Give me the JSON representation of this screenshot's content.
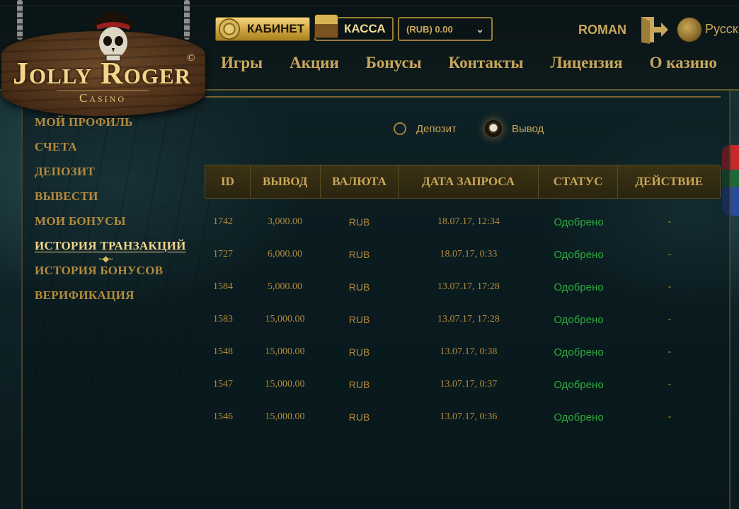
{
  "brand": {
    "title": "Jolly Roger",
    "subtitle": "Casino",
    "copyright": "©"
  },
  "header": {
    "cabinet_label": "КАБИНЕТ",
    "kassa_label": "КАССА",
    "balance": "(RUB) 0.00",
    "username": "ROMAN",
    "language": "Русск"
  },
  "nav": [
    "Игры",
    "Акции",
    "Бонусы",
    "Контакты",
    "Лицензия",
    "О казино"
  ],
  "sidebar": {
    "items": [
      {
        "label": "МОЙ ПРОФИЛЬ"
      },
      {
        "label": "СЧЕТА"
      },
      {
        "label": "ДЕПОЗИТ"
      },
      {
        "label": "ВЫВЕСТИ"
      },
      {
        "label": "МОИ БОНУСЫ"
      },
      {
        "label": "ИСТОРИЯ ТРАНЗАКЦИЙ"
      },
      {
        "label": "ИСТОРИЯ БОНУСОВ"
      },
      {
        "label": "ВЕРИФИКАЦИЯ"
      }
    ],
    "active_index": 5
  },
  "filter": {
    "deposit_label": "Депозит",
    "withdraw_label": "Вывод",
    "selected": "Вывод"
  },
  "table": {
    "headers": [
      "ID",
      "ВЫВОД",
      "ВАЛЮТА",
      "ДАТА ЗАПРОСА",
      "СТАТУС",
      "ДЕЙСТВИЕ"
    ],
    "rows": [
      {
        "id": "1742",
        "amount": "3,000.00",
        "currency": "RUB",
        "date": "18.07.17, 12:34",
        "status": "Одобрено",
        "action": "-"
      },
      {
        "id": "1727",
        "amount": "6,000.00",
        "currency": "RUB",
        "date": "18.07.17, 0:33",
        "status": "Одобрено",
        "action": "-"
      },
      {
        "id": "1584",
        "amount": "5,000.00",
        "currency": "RUB",
        "date": "13.07.17, 17:28",
        "status": "Одобрено",
        "action": "-"
      },
      {
        "id": "1583",
        "amount": "15,000.00",
        "currency": "RUB",
        "date": "13.07.17, 17:28",
        "status": "Одобрено",
        "action": "-"
      },
      {
        "id": "1548",
        "amount": "15,000.00",
        "currency": "RUB",
        "date": "13.07.17, 0:38",
        "status": "Одобрено",
        "action": "-"
      },
      {
        "id": "1547",
        "amount": "15,000.00",
        "currency": "RUB",
        "date": "13.07.17, 0:37",
        "status": "Одобрено",
        "action": "-"
      },
      {
        "id": "1546",
        "amount": "15,000.00",
        "currency": "RUB",
        "date": "13.07.17, 0:36",
        "status": "Одобрено",
        "action": "-"
      }
    ]
  },
  "colors": {
    "gold": "#c9a75a",
    "status_ok": "#2eaa3c",
    "background": "#0b1a1e"
  },
  "icons": [
    "coin-icon",
    "treasure-chest-icon",
    "chevron-down-icon",
    "logout-icon",
    "globe-icon",
    "skull-icon",
    "parrot-icon"
  ]
}
